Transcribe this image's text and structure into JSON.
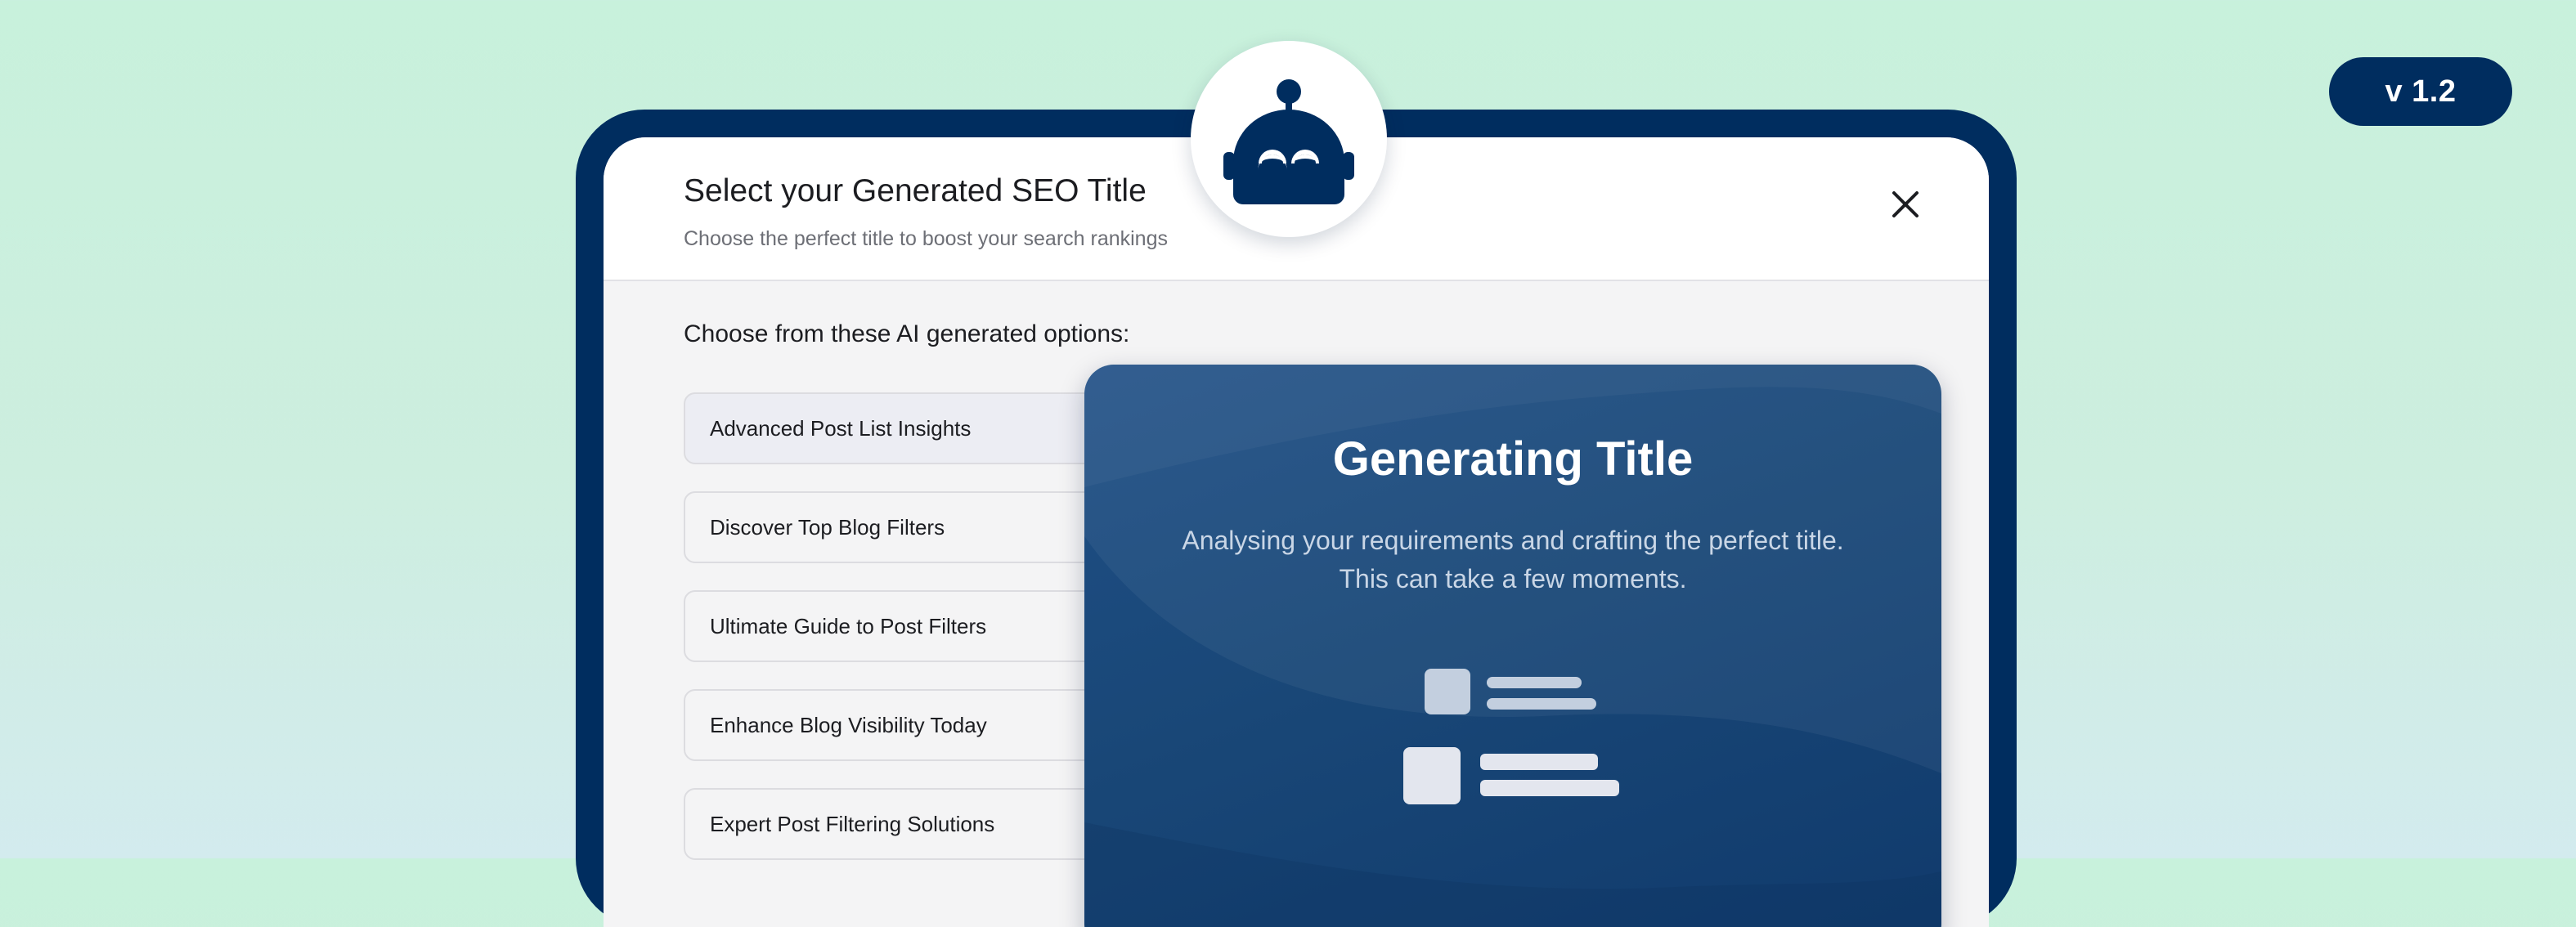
{
  "version_badge": "v 1.2",
  "modal": {
    "title": "Select your Generated SEO Title",
    "subtitle": "Choose the perfect title to boost your search rankings",
    "section_label": "Choose from these AI generated options:",
    "options": [
      {
        "label": "Advanced Post List Insights",
        "selected": true
      },
      {
        "label": "Discover Top Blog Filters",
        "selected": false
      },
      {
        "label": "Ultimate Guide to Post Filters",
        "selected": false
      },
      {
        "label": "Enhance Blog Visibility Today",
        "selected": false
      },
      {
        "label": "Expert Post Filtering Solutions",
        "selected": false
      }
    ]
  },
  "loading": {
    "title": "Generating Title",
    "description_line1": "Analysing your requirements and crafting the perfect title.",
    "description_line2": "This can take a few moments."
  },
  "icons": {
    "close": "close-icon",
    "avatar": "robot-icon"
  },
  "colors": {
    "brand_navy": "#002d5f",
    "card_blue": "#1a4a7c",
    "background_mint": "#c8f1dc"
  }
}
